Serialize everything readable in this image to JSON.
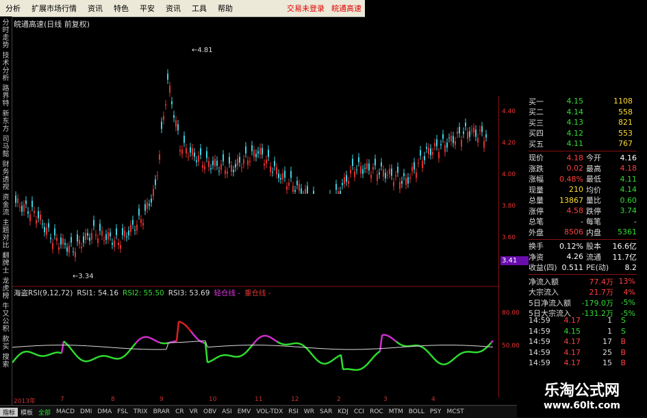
{
  "menu": [
    "分析",
    "扩展市场行情",
    "资讯",
    "特色",
    "平安",
    "资讯",
    "工具",
    "帮助"
  ],
  "menu_right": [
    "交易未登录",
    "皖通高速"
  ],
  "left_tabs": [
    "分时走势",
    "技术分析",
    "路界特",
    "新东方",
    "司马懿",
    "财务透视",
    "资金流",
    "主题对比",
    "翻牌士",
    "龙虎榜",
    "牛又公积",
    "款买",
    "搜索"
  ],
  "title": "皖通高速(日线 前复权)",
  "price_axis": [
    "4.40",
    "4.20",
    "4.00",
    "3.80",
    "3.60"
  ],
  "current_price": "3.41",
  "annotations": {
    "high": "4.81",
    "low": "3.34"
  },
  "rsi_legend": [
    {
      "text": "海盗RSI(9,12,72)",
      "color": "#dddddd"
    },
    {
      "text": "RSI1: 54.16",
      "color": "#dddddd"
    },
    {
      "text": "RSI2: 55.50",
      "color": "#33dd33"
    },
    {
      "text": "RSI3: 53.69",
      "color": "#dddddd"
    },
    {
      "text": "轻仓线 -",
      "color": "#dd33dd"
    },
    {
      "text": "重仓线 -",
      "color": "#dd3333"
    }
  ],
  "rsi_axis": [
    "80.00",
    "50.00"
  ],
  "quote": {
    "buy": [
      {
        "label": "买一",
        "price": "4.15",
        "vol": "1108"
      },
      {
        "label": "买二",
        "price": "4.14",
        "vol": "558"
      },
      {
        "label": "买三",
        "price": "4.13",
        "vol": "821"
      },
      {
        "label": "买四",
        "price": "4.12",
        "vol": "553"
      },
      {
        "label": "买五",
        "price": "4.11",
        "vol": "767"
      }
    ],
    "stats": [
      {
        "l": "现价",
        "v": "4.18",
        "vc": "#ff4040",
        "l2": "今开",
        "v2": "4.16",
        "v2c": "#ffffff"
      },
      {
        "l": "涨跌",
        "v": "0.02",
        "vc": "#ff4040",
        "l2": "最高",
        "v2": "4.18",
        "v2c": "#ff4040"
      },
      {
        "l": "涨幅",
        "v": "0.48%",
        "vc": "#ff4040",
        "l2": "最低",
        "v2": "4.11",
        "v2c": "#33dd33"
      },
      {
        "l": "现量",
        "v": "210",
        "vc": "#ffdd33",
        "l2": "均价",
        "v2": "4.14",
        "v2c": "#33dd33"
      },
      {
        "l": "总量",
        "v": "13867",
        "vc": "#ffdd33",
        "l2": "量比",
        "v2": "0.60",
        "v2c": "#33dd33"
      },
      {
        "l": "涨停",
        "v": "4.58",
        "vc": "#ff4040",
        "l2": "跌停",
        "v2": "3.74",
        "v2c": "#33dd33"
      },
      {
        "l": "总笔",
        "v": "-",
        "vc": "#dddddd",
        "l2": "每笔",
        "v2": "-",
        "v2c": "#dddddd"
      },
      {
        "l": "外盘",
        "v": "8506",
        "vc": "#ff4040",
        "l2": "内盘",
        "v2": "5361",
        "v2c": "#33dd33"
      }
    ],
    "fund": [
      {
        "l": "换手",
        "v": "0.12%",
        "vc": "#ffffff",
        "l2": "股本",
        "v2": "16.6亿",
        "v2c": "#ffffff"
      },
      {
        "l": "净资",
        "v": "4.26",
        "vc": "#ffffff",
        "l2": "流通",
        "v2": "11.7亿",
        "v2c": "#ffffff"
      },
      {
        "l": "收益(四)",
        "v": "0.511",
        "vc": "#ffffff",
        "l2": "PE(动)",
        "v2": "8.2",
        "v2c": "#ffffff"
      }
    ],
    "flow": [
      {
        "l": "净流入额",
        "v": "77.4万",
        "p": "13%",
        "c": "#ff4040"
      },
      {
        "l": "大宗流入",
        "v": "21.7万",
        "p": "4%",
        "c": "#ff4040"
      },
      {
        "l": "5日净流入额",
        "v": "-179.0万",
        "p": "-5%",
        "c": "#33dd33"
      },
      {
        "l": "5日大宗流入",
        "v": "-131.2万",
        "p": "-5%",
        "c": "#33dd33"
      }
    ]
  },
  "ticks": [
    {
      "t": "14:59",
      "p": "4.17",
      "pc": "#ff4040",
      "n": "1",
      "d": "S",
      "dc": "#33dd33"
    },
    {
      "t": "14:59",
      "p": "4.15",
      "pc": "#33dd33",
      "n": "1",
      "d": "S",
      "dc": "#33dd33"
    },
    {
      "t": "14:59",
      "p": "4.17",
      "pc": "#ff4040",
      "n": "17",
      "d": "B",
      "dc": "#ff4040"
    },
    {
      "t": "14:59",
      "p": "4.17",
      "pc": "#ff4040",
      "n": "25",
      "d": "B",
      "dc": "#ff4040"
    },
    {
      "t": "14:59",
      "p": "4.17",
      "pc": "#ff4040",
      "n": "15",
      "d": "B",
      "dc": "#ff4040"
    }
  ],
  "xaxis": [
    "2013年",
    "7",
    "8",
    "9",
    "10",
    "11",
    "12",
    "2",
    "3",
    "4"
  ],
  "bottom_tabs": [
    "指标",
    "模板",
    "全部",
    "MACD",
    "DMI",
    "DMA",
    "FSL",
    "TRIX",
    "BRAR",
    "CR",
    "VR",
    "OBV",
    "ASI",
    "EMV",
    "VOL-TDX",
    "RSI",
    "WR",
    "SAR",
    "KDJ",
    "CCI",
    "ROC",
    "MTM",
    "BOLL",
    "PSY",
    "MCST"
  ],
  "watermark": {
    "line1": "乐淘公式网",
    "line2": "www.60lt.com"
  }
}
